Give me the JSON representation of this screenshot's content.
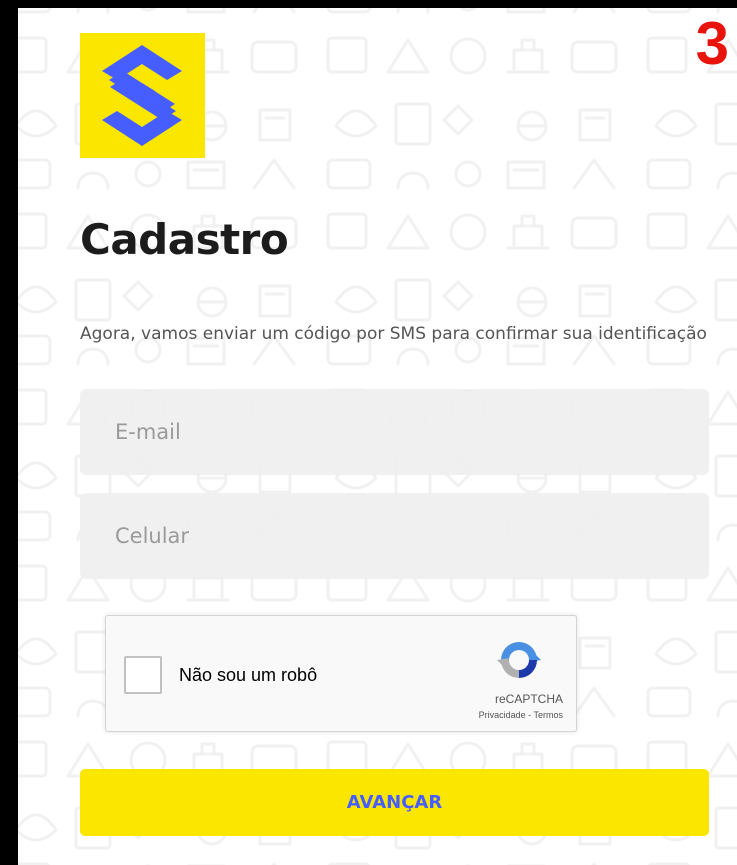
{
  "overlay": {
    "step_number": "3"
  },
  "brand": {
    "logo_icon": "banco-do-brasil-logo-icon",
    "logo_background": "#fbe600",
    "logo_mark_color": "#465eff"
  },
  "page": {
    "title": "Cadastro",
    "subtitle": "Agora, vamos enviar um código por SMS para confirmar sua identificação"
  },
  "form": {
    "email": {
      "placeholder": "E-mail",
      "value": ""
    },
    "phone": {
      "placeholder": "Celular",
      "value": ""
    }
  },
  "recaptcha": {
    "label": "Não sou um robô",
    "checked": false,
    "brand": "reCAPTCHA",
    "privacy_link": "Privacidade",
    "separator": " - ",
    "terms_link": "Termos",
    "logo_icon": "recaptcha-logo-icon"
  },
  "actions": {
    "submit_label": "AVANÇAR"
  },
  "colors": {
    "accent_yellow": "#fbe600",
    "accent_blue": "#465eff",
    "overlay_red": "#e8140c",
    "field_background": "#eeeeee"
  }
}
